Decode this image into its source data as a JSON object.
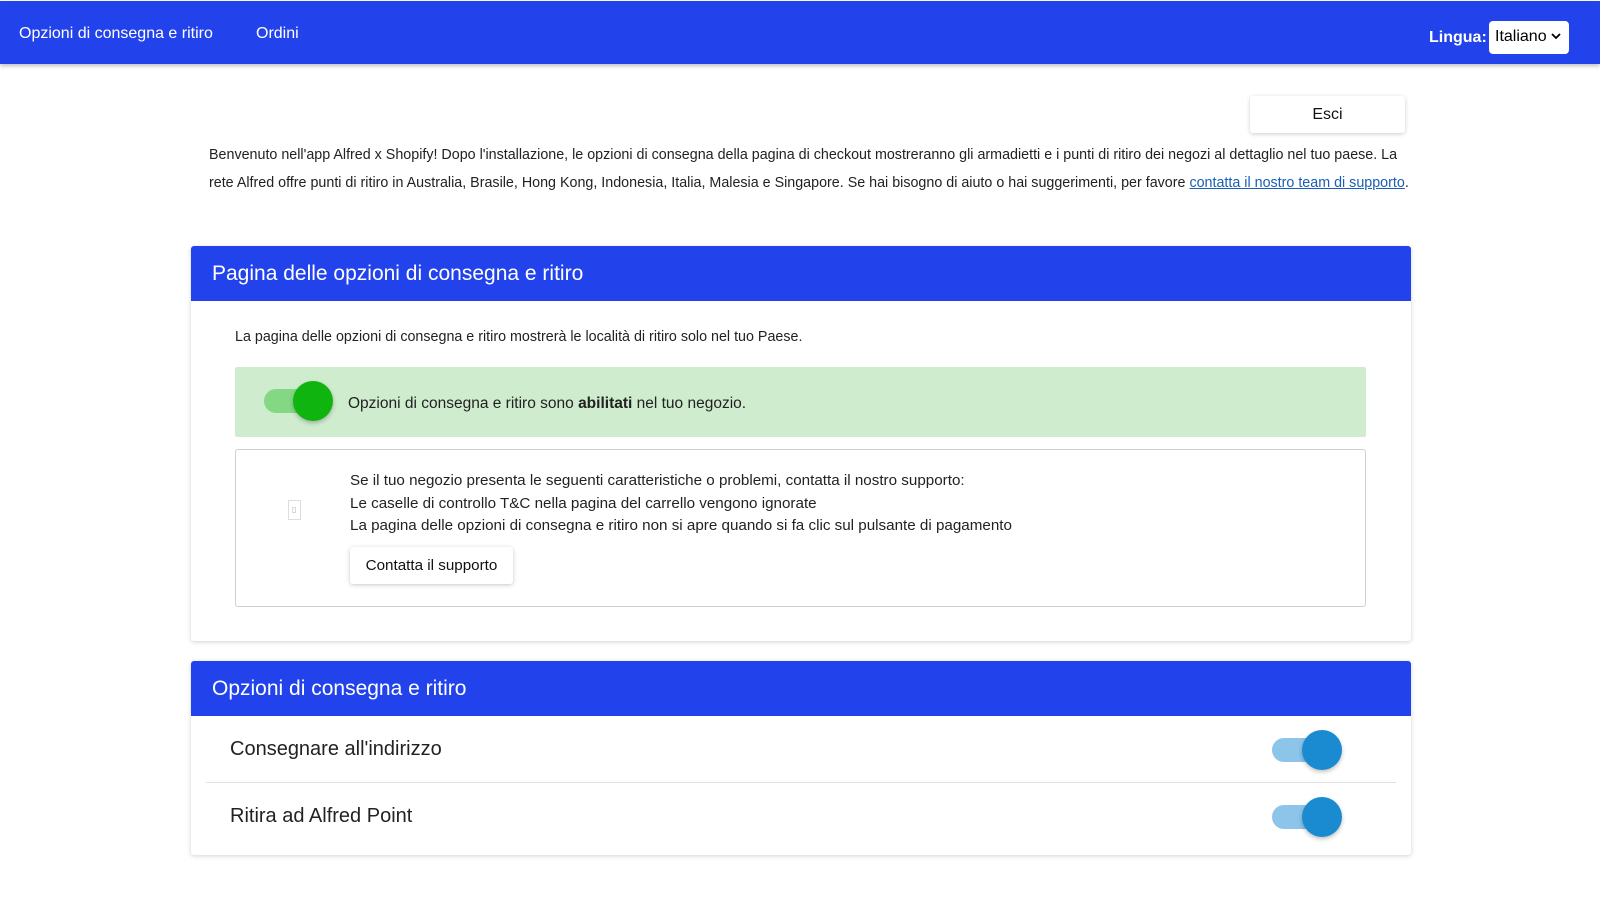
{
  "nav": {
    "items": [
      {
        "label": "Opzioni di consegna e ritiro"
      },
      {
        "label": "Ordini"
      }
    ],
    "language_label": "Lingua:",
    "language_value": "Italiano"
  },
  "logout_label": "Esci",
  "intro": {
    "text_before_link": "Benvenuto nell'app Alfred x Shopify! Dopo l'installazione, le opzioni di consegna della pagina di checkout mostreranno gli armadietti e i punti di ritiro dei negozi al dettaglio nel tuo paese. La rete Alfred offre punti di ritiro in Australia, Brasile, Hong Kong, Indonesia, Italia, Malesia e Singapore. Se hai bisogno di aiuto o hai suggerimenti, per favore ",
    "link_text": "contatta il nostro team di supporto",
    "text_after_link": "."
  },
  "delivery_page_card": {
    "title": "Pagina delle opzioni di consegna e ritiro",
    "description": "La pagina delle opzioni di consegna e ritiro mostrerà le località di ritiro solo nel tuo Paese.",
    "status_prefix": "Opzioni di consegna e ritiro sono ",
    "status_strong": "abilitati",
    "status_suffix": " nel tuo negozio.",
    "status_enabled": true,
    "issues": {
      "intro": "Se il tuo negozio presenta le seguenti caratteristiche o problemi, contatta il nostro supporto:",
      "items": [
        "Le caselle di controllo T&C nella pagina del carrello vengono ignorate",
        "La pagina delle opzioni di consegna e ritiro non si apre quando si fa clic sul pulsante di pagamento"
      ],
      "button_label": "Contatta il supporto"
    }
  },
  "options_card": {
    "title": "Opzioni di consegna e ritiro",
    "options": [
      {
        "label": "Consegnare all'indirizzo",
        "enabled": true
      },
      {
        "label": "Ritira ad Alfred Point",
        "enabled": true
      }
    ]
  },
  "colors": {
    "brand_blue": "#2243ec",
    "enabled_bg": "#cfeccf",
    "toggle_green": "#0fb40f",
    "toggle_blue": "#1b8bd1"
  }
}
